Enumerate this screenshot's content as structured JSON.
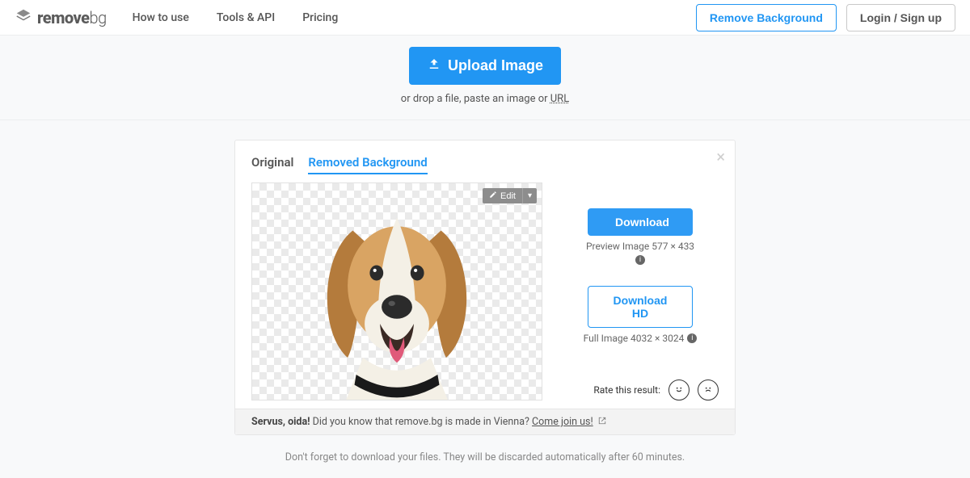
{
  "brand": {
    "name_bold": "remove",
    "name_light": "bg"
  },
  "nav": {
    "how": "How to use",
    "tools": "Tools & API",
    "pricing": "Pricing"
  },
  "header_actions": {
    "remove_bg": "Remove Background",
    "login": "Login / Sign up"
  },
  "upload": {
    "button": "Upload Image",
    "hint_prefix": "or drop a file, paste an image or ",
    "hint_url": "URL"
  },
  "tabs": {
    "original": "Original",
    "removed": "Removed Background"
  },
  "editor": {
    "edit_label": "Edit"
  },
  "downloads": {
    "primary": "Download",
    "preview_dim": "Preview Image 577 × 433",
    "hd": "Download HD",
    "full_dim": "Full Image 4032 × 3024"
  },
  "rating": {
    "label": "Rate this result:"
  },
  "banner": {
    "greeting": "Servus, oida!",
    "body": " Did you know that remove.bg is made in Vienna? ",
    "cta": "Come join us!"
  },
  "discard_note": "Don't forget to download your files. They will be discarded automatically after 60 minutes."
}
